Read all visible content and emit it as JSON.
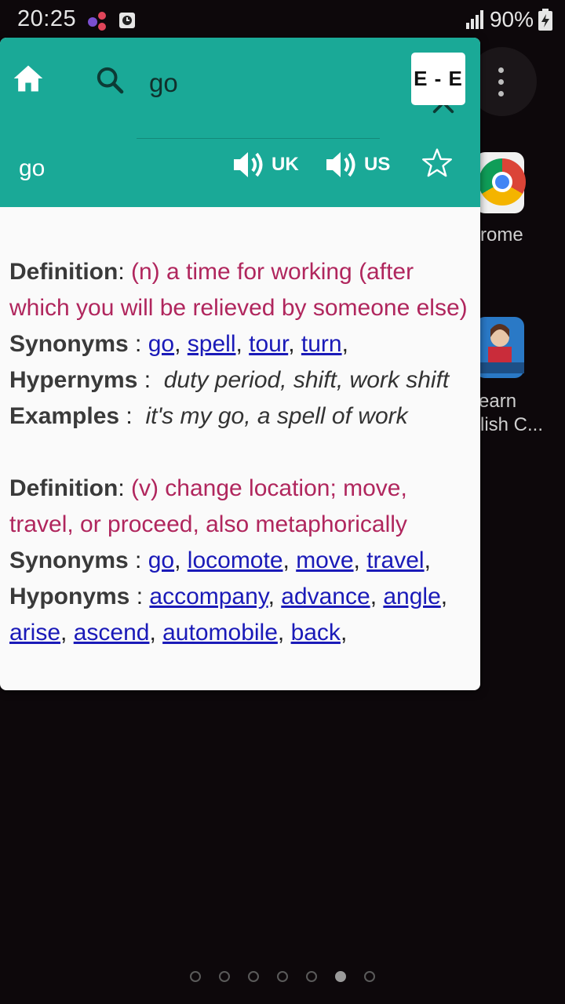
{
  "status_bar": {
    "time": "20:25",
    "battery": "90%"
  },
  "search": {
    "value": "go",
    "lang_button": "E - E"
  },
  "word": {
    "title": "go",
    "uk_label": "UK",
    "us_label": "US"
  },
  "entries": [
    {
      "definition_label": "Definition",
      "definition": "(n) a time for working (after which you will be relieved by someone else)",
      "synonyms_label": "Synonyms",
      "synonyms": [
        "go",
        "spell",
        "tour",
        "turn"
      ],
      "hypernyms_label": "Hypernyms",
      "hypernyms": "duty period, shift, work shift",
      "examples_label": "Examples",
      "examples": "it's my go, a spell of work"
    },
    {
      "definition_label": "Definition",
      "definition": "(v) change location; move, travel, or proceed, also metaphorically",
      "synonyms_label": "Synonyms",
      "synonyms": [
        "go",
        "locomote",
        "move",
        "travel"
      ],
      "hyponyms_label": "Hyponyms",
      "hyponyms": [
        "accompany",
        "advance",
        "angle",
        "arise",
        "ascend",
        "automobile",
        "back"
      ]
    }
  ],
  "background": {
    "chrome_label": "rome",
    "app2_label_line1": "earn",
    "app2_label_line2": "lish C..."
  },
  "colors": {
    "header": "#1aa997",
    "definition": "#b0265d",
    "link": "#1a1ab8"
  }
}
